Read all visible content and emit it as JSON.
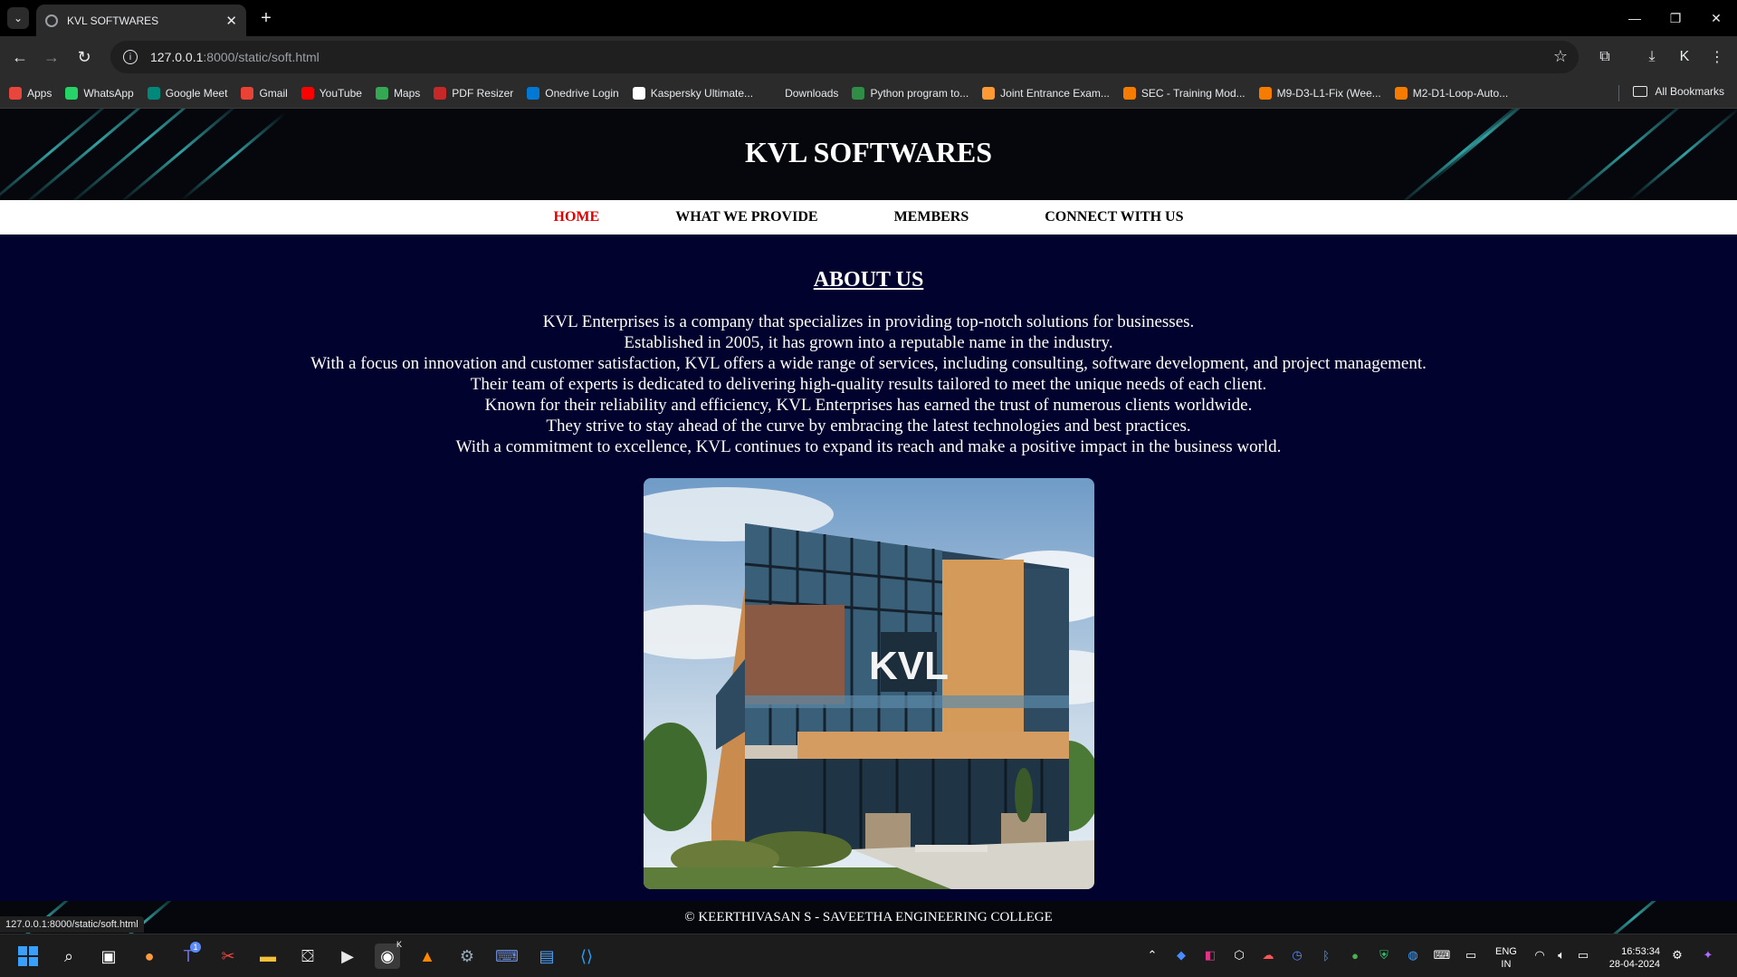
{
  "browser": {
    "tab_title": "KVL SOFTWARES",
    "url_host": "127.0.0.1",
    "url_path": ":8000/static/soft.html",
    "status_url": "127.0.0.1:8000/static/soft.html"
  },
  "bookmarks": {
    "items": [
      {
        "label": "Apps",
        "icon": "apps-grid-icon",
        "color": "#e8453c"
      },
      {
        "label": "WhatsApp",
        "icon": "whatsapp-icon",
        "color": "#25d366"
      },
      {
        "label": "Google Meet",
        "icon": "google-meet-icon",
        "color": "#00897b"
      },
      {
        "label": "Gmail",
        "icon": "gmail-icon",
        "color": "#ea4335"
      },
      {
        "label": "YouTube",
        "icon": "youtube-icon",
        "color": "#ff0000"
      },
      {
        "label": "Maps",
        "icon": "maps-icon",
        "color": "#34a853"
      },
      {
        "label": "PDF Resizer",
        "icon": "pdf-resizer-icon",
        "color": "#c62828"
      },
      {
        "label": "Onedrive Login",
        "icon": "onedrive-icon",
        "color": "#0078d4"
      },
      {
        "label": "Kaspersky Ultimate...",
        "icon": "kaspersky-icon",
        "color": "#ffffff"
      },
      {
        "label": "Downloads",
        "icon": "download-icon",
        "color": "#2b2b2b"
      },
      {
        "label": "Python program to...",
        "icon": "python-site-icon",
        "color": "#2f8d46"
      },
      {
        "label": "Joint Entrance Exam...",
        "icon": "india-flag-icon",
        "color": "#ff9933"
      },
      {
        "label": "SEC - Training Mod...",
        "icon": "sec-training-icon",
        "color": "#f57c00"
      },
      {
        "label": "M9-D3-L1-Fix (Wee...",
        "icon": "sec-training-icon",
        "color": "#f57c00"
      },
      {
        "label": "M2-D1-Loop-Auto...",
        "icon": "sec-training-icon",
        "color": "#f57c00"
      }
    ],
    "all_label": "All Bookmarks"
  },
  "site": {
    "title": "KVL SOFTWARES",
    "nav": [
      "HOME",
      "WHAT WE PROVIDE",
      "MEMBERS",
      "CONNECT WITH US"
    ],
    "active_nav": "HOME",
    "about_title": "ABOUT US",
    "about_lines": [
      "KVL Enterprises is a company that specializes in providing top-notch solutions for businesses.",
      "Established in 2005, it has grown into a reputable name in the industry.",
      "With a focus on innovation and customer satisfaction, KVL offers a wide range of services, including consulting, software development, and project management.",
      "Their team of experts is dedicated to delivering high-quality results tailored to meet the unique needs of each client.",
      "Known for their reliability and efficiency, KVL Enterprises has earned the trust of numerous clients worldwide.",
      "They strive to stay ahead of the curve by embracing the latest technologies and best practices.",
      "With a commitment to excellence, KVL continues to expand its reach and make a positive impact in the business world."
    ],
    "building_sign": "KVL",
    "footer": "© KEERTHIVASAN S - SAVEETHA ENGINEERING COLLEGE"
  },
  "taskbar": {
    "lang_top": "ENG",
    "lang_bottom": "IN",
    "time": "16:53:34",
    "date": "28-04-2024",
    "teams_badge": "1",
    "chrome_badge": "K"
  },
  "colors": {
    "page_bg": "#02022e",
    "nav_active": "#e00000",
    "header_bg": "#05070c"
  }
}
